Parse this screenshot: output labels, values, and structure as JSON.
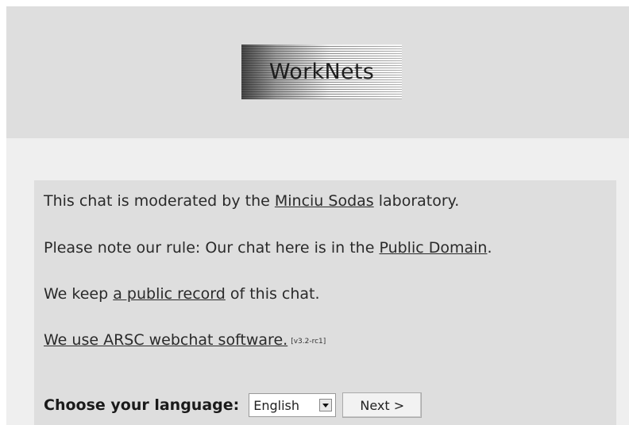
{
  "header": {
    "logo_text": "WorkNets"
  },
  "intro": {
    "line1_prefix": "This chat is moderated by the ",
    "line1_link": "Minciu Sodas",
    "line1_suffix": " laboratory.",
    "line2_prefix": "Please note our rule: Our chat here is in the ",
    "line2_link": "Public Domain",
    "line2_suffix": ".",
    "line3_prefix": "We keep ",
    "line3_link": "a public record",
    "line3_suffix": " of this chat.",
    "line4_link": "We use ARSC webchat software.",
    "version": "[v3.2-rc1]"
  },
  "language": {
    "label": "Choose your language:",
    "selected": "English",
    "next_label": "Next >"
  }
}
